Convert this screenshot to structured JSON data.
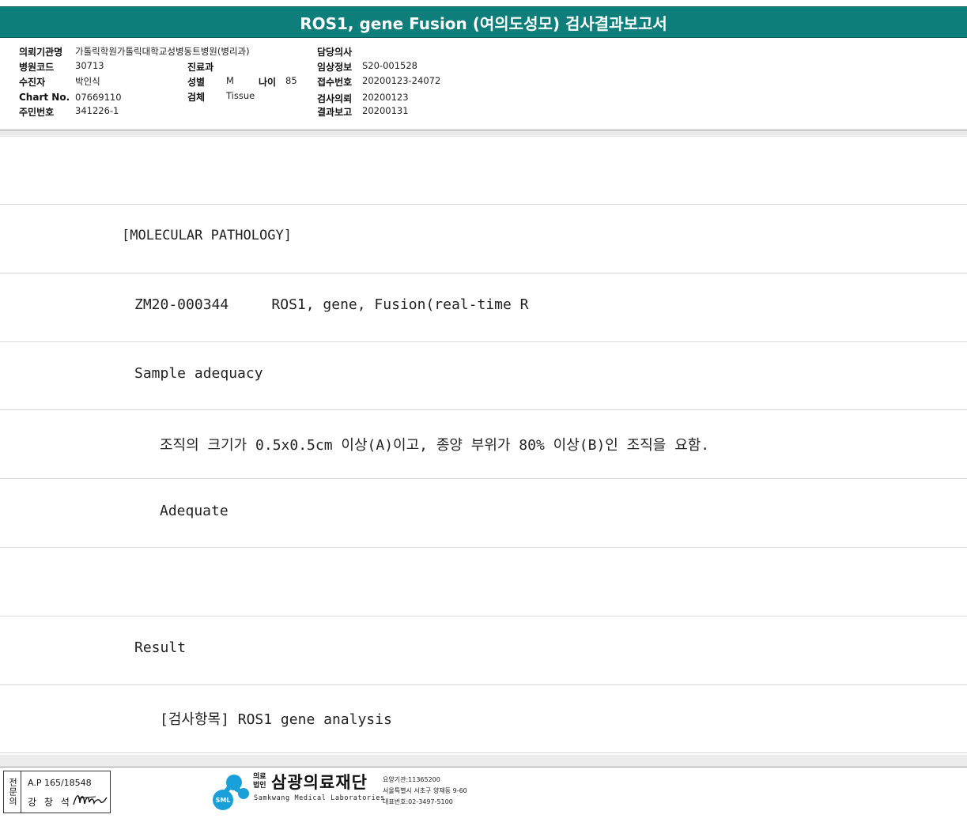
{
  "report": {
    "title": "ROS1, gene Fusion (여의도성모) 검사결과보고서",
    "accent_color": "#0e7e7a"
  },
  "header": {
    "institution": {
      "label": "의뢰기관명",
      "value": "가톨릭학원가톨릭대학교성병동트병원(병리과)"
    },
    "hospital_code": {
      "label": "병원코드",
      "value": "30713"
    },
    "patient_name": {
      "label": "수진자",
      "value": "박인식"
    },
    "chart_no": {
      "label": "Chart No.",
      "value": "07669110"
    },
    "resident_no": {
      "label": "주민번호",
      "value": "341226-1"
    },
    "department": {
      "label": "진료과",
      "value": ""
    },
    "sex": {
      "label": "성별",
      "value": "M"
    },
    "age": {
      "label": "나이",
      "value": "85"
    },
    "specimen": {
      "label": "검체",
      "value": "Tissue"
    },
    "physician": {
      "label": "담당의사",
      "value": ""
    },
    "clinical_info": {
      "label": "임상정보",
      "value": "S20-001528"
    },
    "receipt_no": {
      "label": "접수번호",
      "value": "20200123-24072"
    },
    "request_date": {
      "label": "검사의뢰",
      "value": "20200123"
    },
    "report_date": {
      "label": "결과보고",
      "value": "20200131"
    }
  },
  "body": {
    "lines": [
      "",
      "[MOLECULAR PATHOLOGY]",
      "ZM20-000344     ROS1, gene, Fusion(real-time R",
      "Sample adequacy",
      "조직의 크기가 0.5x0.5cm 이상(A)이고, 종양 부위가 80% 이상(B)인 조직을 요함.",
      "Adequate",
      "",
      "Result",
      "[검사항목] ROS1 gene analysis"
    ]
  },
  "footer": {
    "specialist_tag": "전문의",
    "specialist_ap": "A.P 165/18548",
    "specialist_name": "강 창 석",
    "lab_logo_text": "SML",
    "lab_prefix": "의료법인",
    "lab_name_kr": "삼광의료재단",
    "lab_name_en": "Samkwang Medical Laboratories",
    "lab_code": "요양기관:11365200",
    "lab_address": "서울특별시 서초구 양재동 9-60",
    "lab_phone": "대표번호:02-3497-5100"
  }
}
